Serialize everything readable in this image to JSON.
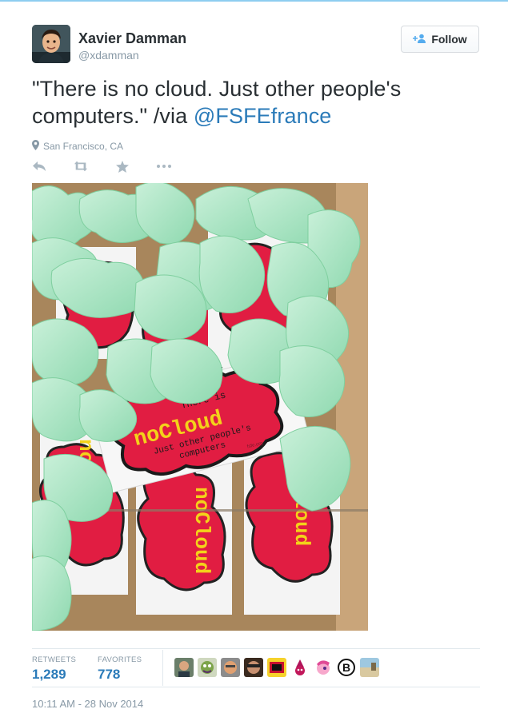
{
  "user": {
    "name": "Xavier Damman",
    "handle": "@xdamman"
  },
  "follow_button": {
    "label": "Follow"
  },
  "tweet": {
    "text_before": "\"There is no cloud. Just other people's computers.\" /via ",
    "mention": "@FSFEfrance",
    "location": "San Francisco, CA"
  },
  "actions": [
    "reply-icon",
    "retweet-icon",
    "favorite-icon",
    "more-icon"
  ],
  "photo": {
    "card_line1": "There is",
    "card_line2": "noCloud",
    "card_line3": "Just other people's",
    "card_line4": "computers",
    "card_small": "fsfe.org"
  },
  "stats": {
    "retweets_label": "RETWEETS",
    "retweets_value": "1,289",
    "favorites_label": "FAVORITES",
    "favorites_value": "778"
  },
  "timestamp": "10:11 AM - 28 Nov 2014",
  "colors": {
    "link": "#2b7bb9",
    "muted": "#8899a6",
    "text": "#292f33",
    "card_red": "#e11d42",
    "card_yellow": "#f3d21a",
    "foam_green": "#a8e4c0"
  }
}
